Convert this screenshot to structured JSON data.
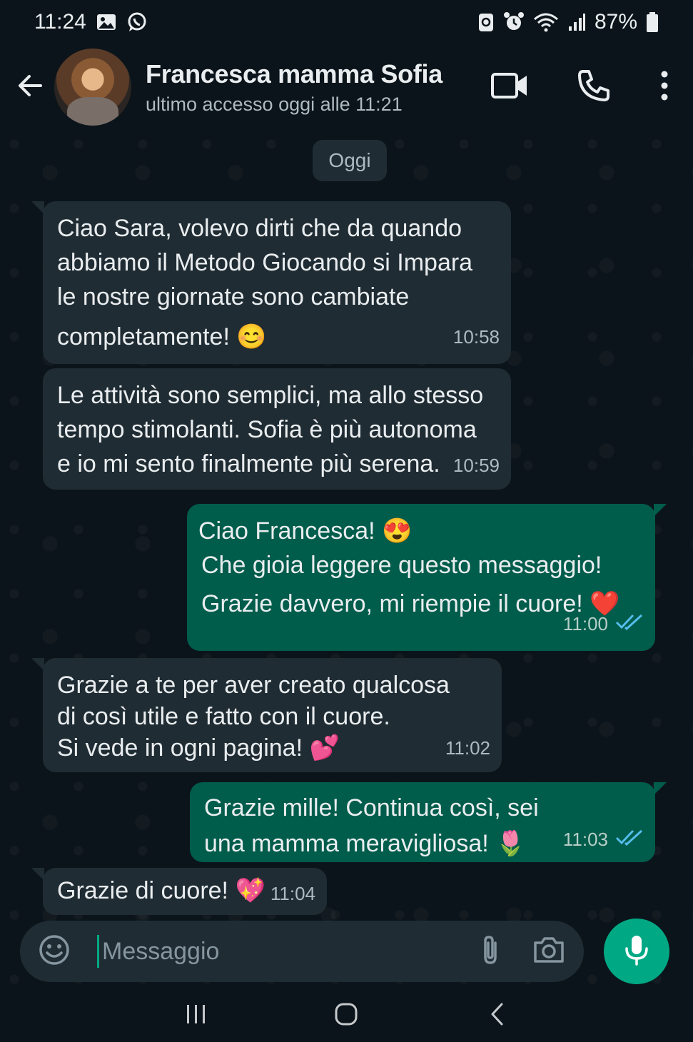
{
  "status_bar": {
    "time": "11:24",
    "battery": "87%",
    "icons": [
      "gallery-icon",
      "whatsapp-icon",
      "sync-icon",
      "alarm-icon",
      "wifi-icon",
      "signal-icon",
      "battery-icon"
    ]
  },
  "header": {
    "contact_name": "Francesca mamma Sofia",
    "last_seen": "ultimo accesso oggi alle 11:21",
    "icons": [
      "back-arrow-icon",
      "video-call-icon",
      "phone-icon",
      "more-vert-icon"
    ]
  },
  "chat": {
    "date_chip": "Oggi",
    "messages": [
      {
        "direction": "in",
        "lines": [
          "Ciao Sara, volevo dirti che da quando",
          "abbiamo il Metodo Giocando si Impara",
          "le nostre giornate sono cambiate",
          "completamente! 😊"
        ],
        "time": "10:58"
      },
      {
        "direction": "in",
        "lines": [
          "Le attività sono semplici, ma allo stesso",
          "tempo stimolanti. Sofia è più autonoma",
          "e io mi sento finalmente più serena."
        ],
        "time": "10:59"
      },
      {
        "direction": "out",
        "lines": [
          "Ciao Francesca! 😍",
          "Che gioia leggere questo messaggio!",
          "Grazie davvero, mi riempie il cuore! ❤️"
        ],
        "time": "11:00",
        "read": true
      },
      {
        "direction": "in",
        "lines": [
          "Grazie a te per aver creato qualcosa",
          "di così utile e fatto con il cuore.",
          "Si vede in ogni pagina! 💕"
        ],
        "time": "11:02"
      },
      {
        "direction": "out",
        "lines": [
          "Grazie mille! Continua così, sei",
          "una mamma meravigliosa! 🌷"
        ],
        "time": "11:03",
        "read": true
      },
      {
        "direction": "in",
        "lines": [
          "Grazie di cuore! 💖"
        ],
        "time": "11:04"
      }
    ]
  },
  "composer": {
    "placeholder": "Messaggio",
    "icons": [
      "emoji-icon",
      "attach-icon",
      "camera-icon",
      "mic-icon"
    ]
  },
  "nav_bar": {
    "icons": [
      "recents-icon",
      "home-icon",
      "back-nav-icon"
    ]
  },
  "colors": {
    "background": "#0b141a",
    "incoming_bubble": "#202c33",
    "outgoing_bubble": "#005c4b",
    "accent": "#00a884",
    "read_ticks": "#53bdeb"
  }
}
